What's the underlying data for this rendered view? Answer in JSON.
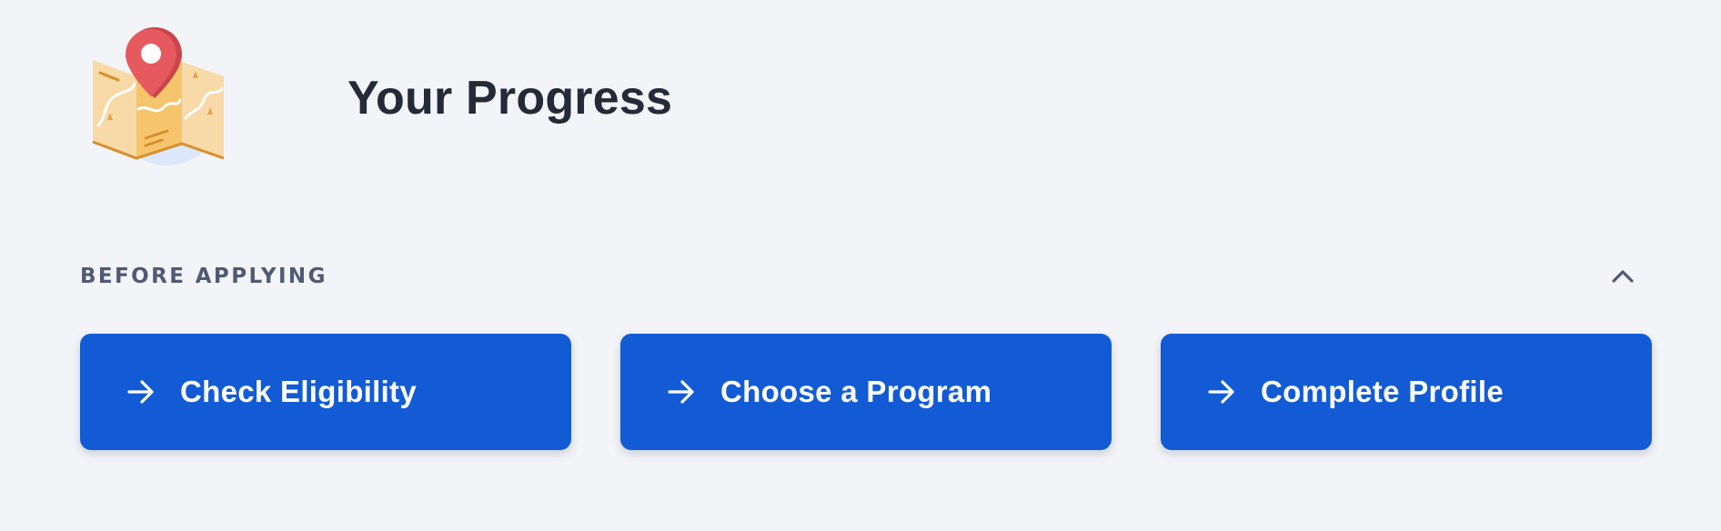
{
  "header": {
    "title": "Your Progress",
    "illustration_icon": "map-with-location-pin-icon"
  },
  "section": {
    "title": "BEFORE APPLYING",
    "toggle_icon": "chevron-up-icon",
    "expanded": true
  },
  "steps": [
    {
      "label": "Check Eligibility",
      "icon": "arrow-right-icon"
    },
    {
      "label": "Choose a Program",
      "icon": "arrow-right-icon"
    },
    {
      "label": "Complete Profile",
      "icon": "arrow-right-icon"
    }
  ],
  "colors": {
    "background": "#f3f4f7",
    "title_text": "#232a38",
    "section_text": "#4f5a74",
    "button_blue": "#125bd5",
    "button_text": "#ffffff",
    "pin_red": "#e65a5f",
    "map_tan": "#f5c46b"
  }
}
